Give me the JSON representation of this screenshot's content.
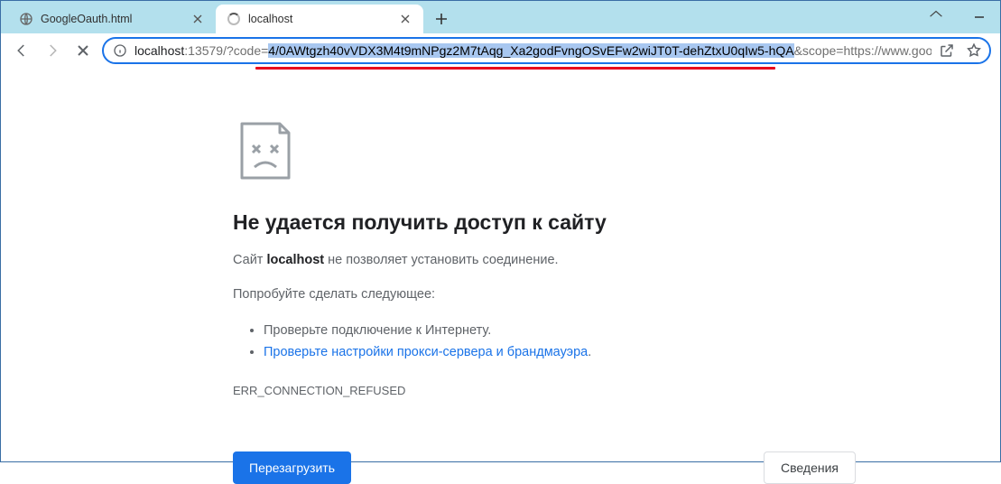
{
  "tabs": {
    "inactive": {
      "title": "GoogleOauth.html"
    },
    "active": {
      "title": "localhost"
    }
  },
  "url": {
    "host": "localhost",
    "pre": ":13579/?code=",
    "selected": "4/0AWtgzh40vVDX3M4t9mNPgz2M7tAqg_Xa2godFvngOSvEFw2wiJT0T-dehZtxU0qIw5-hQA",
    "post": "&scope=https://www.googl"
  },
  "error": {
    "title": "Не удается получить доступ к сайту",
    "site_prefix": "Сайт ",
    "site_host": "localhost",
    "site_suffix": " не позволяет установить соединение.",
    "try_label": "Попробуйте сделать следующее:",
    "suggestions": [
      "Проверьте подключение к Интернету.",
      "Проверьте настройки прокси-сервера и брандмауэра"
    ],
    "suggestion_link_suffix": ".",
    "code": "ERR_CONNECTION_REFUSED",
    "reload_btn": "Перезагрузить",
    "details_btn": "Сведения"
  }
}
